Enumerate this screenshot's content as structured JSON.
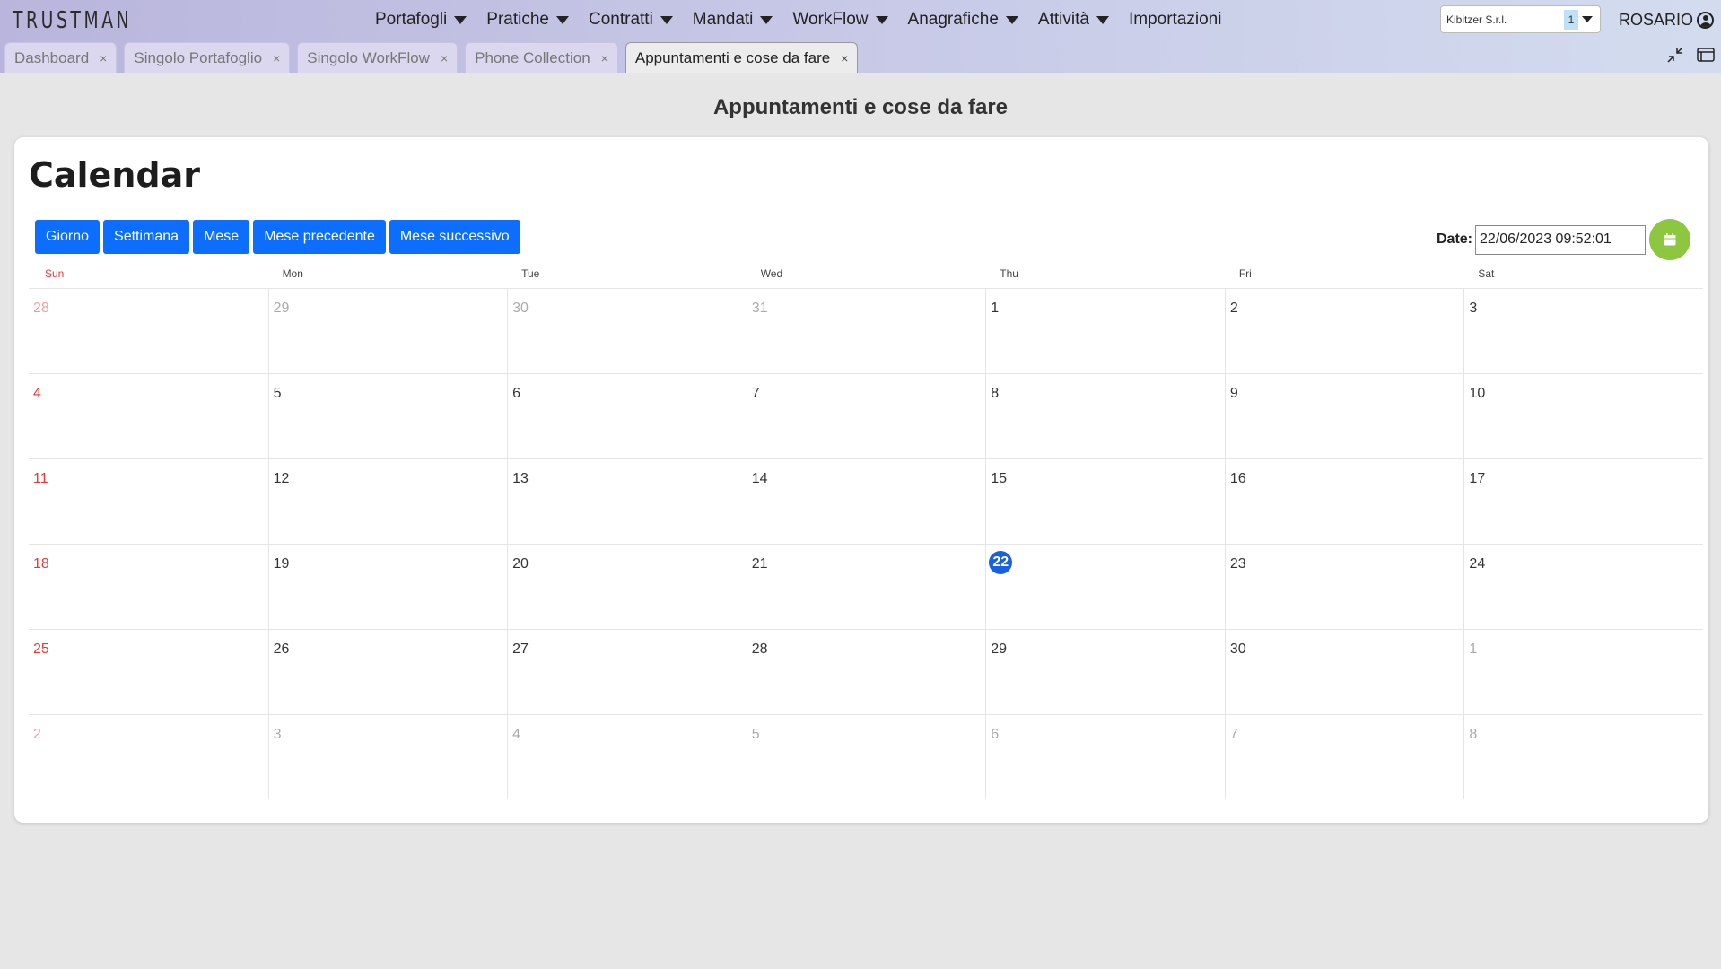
{
  "app": {
    "logo": "TRUSTMAN"
  },
  "nav": {
    "items": [
      {
        "label": "Portafogli",
        "dropdown": true
      },
      {
        "label": "Pratiche",
        "dropdown": true
      },
      {
        "label": "Contratti",
        "dropdown": true
      },
      {
        "label": "Mandati",
        "dropdown": true
      },
      {
        "label": "WorkFlow",
        "dropdown": true
      },
      {
        "label": "Anagrafiche",
        "dropdown": true
      },
      {
        "label": "Attività",
        "dropdown": true
      },
      {
        "label": "Importazioni",
        "dropdown": false
      }
    ]
  },
  "company": {
    "name": "Kibitzer S.r.l.",
    "count": "1"
  },
  "user": {
    "name": "ROSARIO"
  },
  "tabs": [
    {
      "label": "Dashboard",
      "active": false
    },
    {
      "label": "Singolo Portafoglio",
      "active": false
    },
    {
      "label": "Singolo WorkFlow",
      "active": false
    },
    {
      "label": "Phone Collection",
      "active": false
    },
    {
      "label": "Appuntamenti e cose da fare",
      "active": true
    }
  ],
  "tab_close_symbol": "×",
  "page": {
    "title": "Appuntamenti e cose da fare"
  },
  "calendar": {
    "title": "Calendar",
    "view_buttons": [
      "Giorno",
      "Settimana",
      "Mese",
      "Mese precedente",
      "Mese successivo"
    ],
    "date_label": "Date:",
    "date_value": "22/06/2023 09:52:01",
    "weekdays": [
      "Sun",
      "Mon",
      "Tue",
      "Wed",
      "Thu",
      "Fri",
      "Sat"
    ],
    "weeks": [
      [
        {
          "d": "28",
          "o": true
        },
        {
          "d": "29",
          "o": true
        },
        {
          "d": "30",
          "o": true
        },
        {
          "d": "31",
          "o": true
        },
        {
          "d": "1"
        },
        {
          "d": "2"
        },
        {
          "d": "3"
        }
      ],
      [
        {
          "d": "4"
        },
        {
          "d": "5"
        },
        {
          "d": "6"
        },
        {
          "d": "7"
        },
        {
          "d": "8"
        },
        {
          "d": "9"
        },
        {
          "d": "10"
        }
      ],
      [
        {
          "d": "11"
        },
        {
          "d": "12"
        },
        {
          "d": "13"
        },
        {
          "d": "14"
        },
        {
          "d": "15"
        },
        {
          "d": "16"
        },
        {
          "d": "17"
        }
      ],
      [
        {
          "d": "18"
        },
        {
          "d": "19"
        },
        {
          "d": "20"
        },
        {
          "d": "21"
        },
        {
          "d": "22",
          "today": true
        },
        {
          "d": "23"
        },
        {
          "d": "24"
        }
      ],
      [
        {
          "d": "25"
        },
        {
          "d": "26"
        },
        {
          "d": "27"
        },
        {
          "d": "28"
        },
        {
          "d": "29"
        },
        {
          "d": "30"
        },
        {
          "d": "1",
          "o": true
        }
      ],
      [
        {
          "d": "2",
          "o": true
        },
        {
          "d": "3",
          "o": true
        },
        {
          "d": "4",
          "o": true
        },
        {
          "d": "5",
          "o": true
        },
        {
          "d": "6",
          "o": true
        },
        {
          "d": "7",
          "o": true
        },
        {
          "d": "8",
          "o": true
        }
      ]
    ]
  },
  "colors": {
    "accent": "#0d6efd",
    "today": "#1a5fe0",
    "sunday": "#e53935",
    "calendar_button": "#8dc63f"
  },
  "icons": {
    "nav_caret": "caret-down-icon",
    "user": "user-circle-icon",
    "minimize": "minimize-icon",
    "window": "window-icon",
    "calendar": "calendar-icon"
  }
}
